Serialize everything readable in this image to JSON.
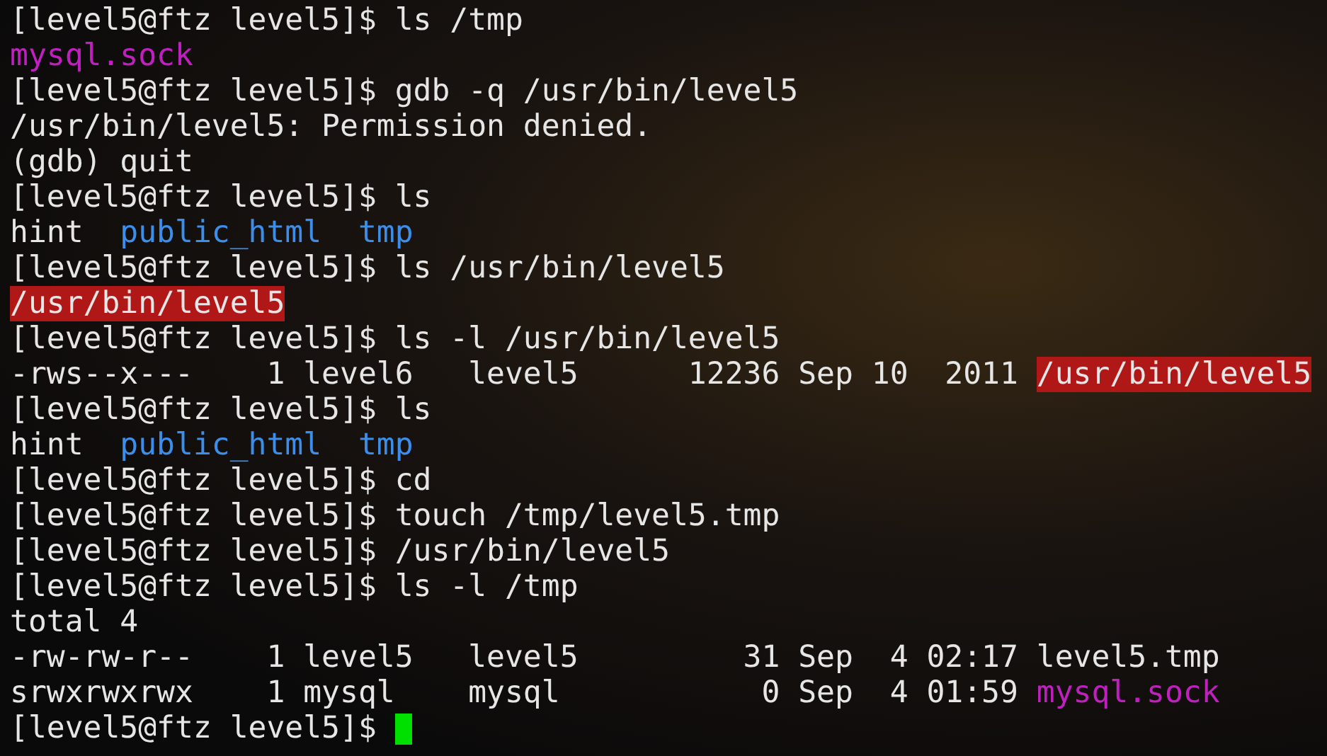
{
  "terminal": {
    "lines": [
      {
        "segments": [
          {
            "kind": "prompt",
            "text": "[level5@ftz level5]$ "
          },
          {
            "kind": "text",
            "text": "ls /tmp"
          }
        ]
      },
      {
        "segments": [
          {
            "kind": "socket",
            "text": "mysql.sock"
          }
        ]
      },
      {
        "segments": [
          {
            "kind": "prompt",
            "text": "[level5@ftz level5]$ "
          },
          {
            "kind": "text",
            "text": "gdb -q /usr/bin/level5"
          }
        ]
      },
      {
        "segments": [
          {
            "kind": "text",
            "text": "/usr/bin/level5: Permission denied."
          }
        ]
      },
      {
        "segments": [
          {
            "kind": "text",
            "text": "(gdb) quit"
          }
        ]
      },
      {
        "segments": [
          {
            "kind": "prompt",
            "text": "[level5@ftz level5]$ "
          },
          {
            "kind": "text",
            "text": "ls"
          }
        ]
      },
      {
        "segments": [
          {
            "kind": "text",
            "text": "hint  "
          },
          {
            "kind": "dir",
            "text": "public_html"
          },
          {
            "kind": "dir",
            "text": "tmp"
          }
        ]
      },
      {
        "segments": [
          {
            "kind": "prompt",
            "text": "[level5@ftz level5]$ "
          },
          {
            "kind": "text",
            "text": "ls /usr/bin/level5"
          }
        ]
      },
      {
        "segments": [
          {
            "kind": "suid",
            "text": "/usr/bin/level5"
          }
        ]
      },
      {
        "segments": [
          {
            "kind": "prompt",
            "text": "[level5@ftz level5]$ "
          },
          {
            "kind": "text",
            "text": "ls -l /usr/bin/level5"
          }
        ]
      },
      {
        "segments": [
          {
            "kind": "text",
            "text": "-rws--x---    1 level6   level5      12236 Sep 10  2011 "
          },
          {
            "kind": "suid",
            "text": "/usr/bin/level5"
          }
        ]
      },
      {
        "segments": [
          {
            "kind": "prompt",
            "text": "[level5@ftz level5]$ "
          },
          {
            "kind": "text",
            "text": "ls"
          }
        ]
      },
      {
        "segments": [
          {
            "kind": "text",
            "text": "hint  "
          },
          {
            "kind": "dir",
            "text": "public_html"
          },
          {
            "kind": "dir",
            "text": "tmp"
          }
        ]
      },
      {
        "segments": [
          {
            "kind": "prompt",
            "text": "[level5@ftz level5]$ "
          },
          {
            "kind": "text",
            "text": "cd"
          }
        ]
      },
      {
        "segments": [
          {
            "kind": "prompt",
            "text": "[level5@ftz level5]$ "
          },
          {
            "kind": "text",
            "text": "touch /tmp/level5.tmp"
          }
        ]
      },
      {
        "segments": [
          {
            "kind": "prompt",
            "text": "[level5@ftz level5]$ "
          },
          {
            "kind": "text",
            "text": "/usr/bin/level5"
          }
        ]
      },
      {
        "segments": [
          {
            "kind": "prompt",
            "text": "[level5@ftz level5]$ "
          },
          {
            "kind": "text",
            "text": "ls -l /tmp"
          }
        ]
      },
      {
        "segments": [
          {
            "kind": "text",
            "text": "total 4"
          }
        ]
      },
      {
        "segments": [
          {
            "kind": "text",
            "text": "-rw-rw-r--    1 level5   level5         31 Sep  4 02:17 level5.tmp"
          }
        ]
      },
      {
        "segments": [
          {
            "kind": "text",
            "text": "srwxrwxrwx    1 mysql    mysql           0 Sep  4 01:59 "
          },
          {
            "kind": "socket",
            "text": "mysql.sock"
          }
        ]
      },
      {
        "segments": [
          {
            "kind": "prompt",
            "text": "[level5@ftz level5]$ "
          }
        ],
        "cursor": true
      }
    ]
  }
}
